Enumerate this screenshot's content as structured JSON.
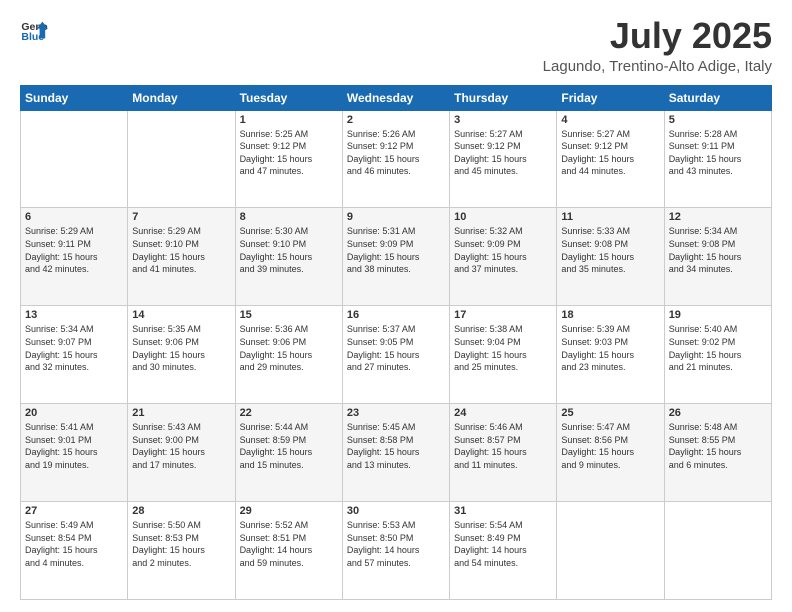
{
  "header": {
    "logo": {
      "line1": "General",
      "line2": "Blue"
    },
    "title": "July 2025",
    "location": "Lagundo, Trentino-Alto Adige, Italy"
  },
  "weekdays": [
    "Sunday",
    "Monday",
    "Tuesday",
    "Wednesday",
    "Thursday",
    "Friday",
    "Saturday"
  ],
  "weeks": [
    [
      {
        "day": "",
        "info": ""
      },
      {
        "day": "",
        "info": ""
      },
      {
        "day": "1",
        "info": "Sunrise: 5:25 AM\nSunset: 9:12 PM\nDaylight: 15 hours\nand 47 minutes."
      },
      {
        "day": "2",
        "info": "Sunrise: 5:26 AM\nSunset: 9:12 PM\nDaylight: 15 hours\nand 46 minutes."
      },
      {
        "day": "3",
        "info": "Sunrise: 5:27 AM\nSunset: 9:12 PM\nDaylight: 15 hours\nand 45 minutes."
      },
      {
        "day": "4",
        "info": "Sunrise: 5:27 AM\nSunset: 9:12 PM\nDaylight: 15 hours\nand 44 minutes."
      },
      {
        "day": "5",
        "info": "Sunrise: 5:28 AM\nSunset: 9:11 PM\nDaylight: 15 hours\nand 43 minutes."
      }
    ],
    [
      {
        "day": "6",
        "info": "Sunrise: 5:29 AM\nSunset: 9:11 PM\nDaylight: 15 hours\nand 42 minutes."
      },
      {
        "day": "7",
        "info": "Sunrise: 5:29 AM\nSunset: 9:10 PM\nDaylight: 15 hours\nand 41 minutes."
      },
      {
        "day": "8",
        "info": "Sunrise: 5:30 AM\nSunset: 9:10 PM\nDaylight: 15 hours\nand 39 minutes."
      },
      {
        "day": "9",
        "info": "Sunrise: 5:31 AM\nSunset: 9:09 PM\nDaylight: 15 hours\nand 38 minutes."
      },
      {
        "day": "10",
        "info": "Sunrise: 5:32 AM\nSunset: 9:09 PM\nDaylight: 15 hours\nand 37 minutes."
      },
      {
        "day": "11",
        "info": "Sunrise: 5:33 AM\nSunset: 9:08 PM\nDaylight: 15 hours\nand 35 minutes."
      },
      {
        "day": "12",
        "info": "Sunrise: 5:34 AM\nSunset: 9:08 PM\nDaylight: 15 hours\nand 34 minutes."
      }
    ],
    [
      {
        "day": "13",
        "info": "Sunrise: 5:34 AM\nSunset: 9:07 PM\nDaylight: 15 hours\nand 32 minutes."
      },
      {
        "day": "14",
        "info": "Sunrise: 5:35 AM\nSunset: 9:06 PM\nDaylight: 15 hours\nand 30 minutes."
      },
      {
        "day": "15",
        "info": "Sunrise: 5:36 AM\nSunset: 9:06 PM\nDaylight: 15 hours\nand 29 minutes."
      },
      {
        "day": "16",
        "info": "Sunrise: 5:37 AM\nSunset: 9:05 PM\nDaylight: 15 hours\nand 27 minutes."
      },
      {
        "day": "17",
        "info": "Sunrise: 5:38 AM\nSunset: 9:04 PM\nDaylight: 15 hours\nand 25 minutes."
      },
      {
        "day": "18",
        "info": "Sunrise: 5:39 AM\nSunset: 9:03 PM\nDaylight: 15 hours\nand 23 minutes."
      },
      {
        "day": "19",
        "info": "Sunrise: 5:40 AM\nSunset: 9:02 PM\nDaylight: 15 hours\nand 21 minutes."
      }
    ],
    [
      {
        "day": "20",
        "info": "Sunrise: 5:41 AM\nSunset: 9:01 PM\nDaylight: 15 hours\nand 19 minutes."
      },
      {
        "day": "21",
        "info": "Sunrise: 5:43 AM\nSunset: 9:00 PM\nDaylight: 15 hours\nand 17 minutes."
      },
      {
        "day": "22",
        "info": "Sunrise: 5:44 AM\nSunset: 8:59 PM\nDaylight: 15 hours\nand 15 minutes."
      },
      {
        "day": "23",
        "info": "Sunrise: 5:45 AM\nSunset: 8:58 PM\nDaylight: 15 hours\nand 13 minutes."
      },
      {
        "day": "24",
        "info": "Sunrise: 5:46 AM\nSunset: 8:57 PM\nDaylight: 15 hours\nand 11 minutes."
      },
      {
        "day": "25",
        "info": "Sunrise: 5:47 AM\nSunset: 8:56 PM\nDaylight: 15 hours\nand 9 minutes."
      },
      {
        "day": "26",
        "info": "Sunrise: 5:48 AM\nSunset: 8:55 PM\nDaylight: 15 hours\nand 6 minutes."
      }
    ],
    [
      {
        "day": "27",
        "info": "Sunrise: 5:49 AM\nSunset: 8:54 PM\nDaylight: 15 hours\nand 4 minutes."
      },
      {
        "day": "28",
        "info": "Sunrise: 5:50 AM\nSunset: 8:53 PM\nDaylight: 15 hours\nand 2 minutes."
      },
      {
        "day": "29",
        "info": "Sunrise: 5:52 AM\nSunset: 8:51 PM\nDaylight: 14 hours\nand 59 minutes."
      },
      {
        "day": "30",
        "info": "Sunrise: 5:53 AM\nSunset: 8:50 PM\nDaylight: 14 hours\nand 57 minutes."
      },
      {
        "day": "31",
        "info": "Sunrise: 5:54 AM\nSunset: 8:49 PM\nDaylight: 14 hours\nand 54 minutes."
      },
      {
        "day": "",
        "info": ""
      },
      {
        "day": "",
        "info": ""
      }
    ]
  ]
}
